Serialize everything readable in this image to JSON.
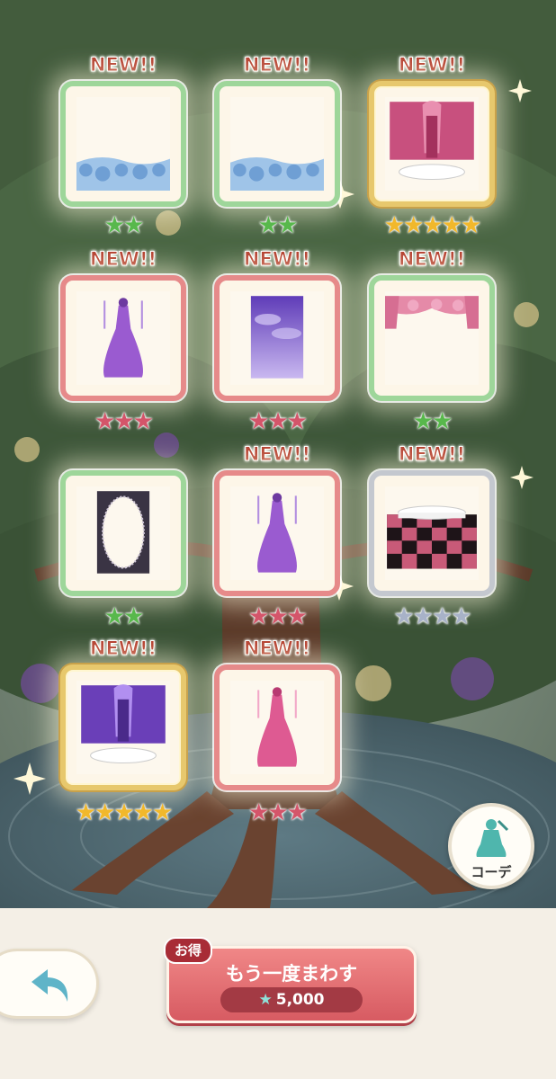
{
  "items": [
    {
      "new_label": "NEW!!",
      "stars": "★★",
      "rarity": "green",
      "image": "blue-rose-frame"
    },
    {
      "new_label": "NEW!!",
      "stars": "★★",
      "rarity": "green",
      "image": "blue-rose-frame"
    },
    {
      "new_label": "NEW!!",
      "stars": "★★★★★",
      "rarity": "gold",
      "image": "pink-castle-stage"
    },
    {
      "new_label": "NEW!!",
      "stars": "★★★",
      "rarity": "pink",
      "image": "purple-candelabra-dress"
    },
    {
      "new_label": "NEW!!",
      "stars": "★★★",
      "rarity": "pink",
      "image": "purple-sky-background"
    },
    {
      "new_label": "NEW!!",
      "stars": "★★",
      "rarity": "green",
      "image": "pink-rose-curtain"
    },
    {
      "new_label": "",
      "stars": "★★",
      "rarity": "green",
      "image": "oval-lace-frame"
    },
    {
      "new_label": "NEW!!",
      "stars": "★★★",
      "rarity": "pink",
      "image": "purple-candelabra-dress"
    },
    {
      "new_label": "NEW!!",
      "stars": "★★★★",
      "rarity": "silver",
      "image": "checkered-floor-stage"
    },
    {
      "new_label": "NEW!!",
      "stars": "★★★★★",
      "rarity": "gold",
      "image": "purple-castle-stage"
    },
    {
      "new_label": "NEW!!",
      "stars": "★★★",
      "rarity": "pink",
      "image": "pink-candelabra-dress"
    }
  ],
  "coord_button": {
    "label": "コーデ",
    "icon": "dress-icon"
  },
  "spin_again": {
    "badge": "お得",
    "label": "もう一度まわす",
    "cost": "5,000",
    "currency_icon": "star-icon"
  },
  "back_button": {
    "icon": "back-arrow-icon"
  },
  "colors": {
    "green": "#9ed69a",
    "pink": "#e68a8a",
    "silver": "#c4c8cf",
    "gold": "#e7c86d",
    "button": "#e06e72",
    "new_text": "#b23a2a"
  }
}
